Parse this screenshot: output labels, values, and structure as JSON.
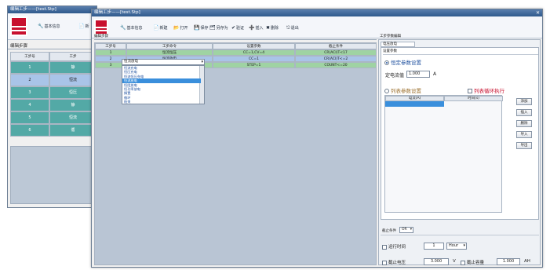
{
  "back_window": {
    "title_prefix": "编辑工步——",
    "title_file": "[test.Stp]",
    "toolbar": [
      {
        "icon": "wrench-icon",
        "label": "基本信息"
      },
      {
        "icon": "new-file-icon",
        "label": "新"
      }
    ],
    "section_title": "编辑步骤",
    "columns": [
      "工步号",
      "工步"
    ],
    "rows": [
      {
        "no": "1",
        "name": "静",
        "style": "teal"
      },
      {
        "no": "2",
        "name": "恒流",
        "style": "blue"
      },
      {
        "no": "3",
        "name": "恒压",
        "style": "teal"
      },
      {
        "no": "4",
        "name": "静",
        "style": "teal"
      },
      {
        "no": "5",
        "name": "恒流",
        "style": "teal"
      },
      {
        "no": "6",
        "name": "循",
        "style": "teal"
      }
    ]
  },
  "front_window": {
    "title": "编辑工步——[test.Stp]",
    "toolbar": [
      {
        "icon": "wrench-icon",
        "label": "基本信息"
      },
      {
        "icon": "new-file-icon",
        "label": "新建"
      },
      {
        "icon": "folder-open-icon",
        "label": "打开"
      },
      {
        "icon": "save-icon",
        "label": "保存"
      },
      {
        "icon": "save-as-icon",
        "label": "另存为"
      },
      {
        "icon": "check-icon",
        "label": "验证"
      },
      {
        "icon": "insert-icon",
        "label": "插入"
      },
      {
        "icon": "delete-icon",
        "label": "删除"
      },
      {
        "icon": "exit-icon",
        "label": "退出"
      }
    ],
    "section_title": "编辑步骤",
    "columns": [
      "工步号",
      "工步命令",
      "设置参数",
      "截止条件"
    ],
    "rows": [
      {
        "no": "1",
        "cmd": "恒流恒压",
        "param": "CC=1,CV=4",
        "cutoff": "CR(ACI)T<17",
        "style": "green"
      },
      {
        "no": "2",
        "cmd": "恒流放电",
        "param": "CC=1",
        "cutoff": "CR(ACI)T<=2",
        "style": "blue"
      },
      {
        "no": "3",
        "cmd": "",
        "param": "STEP=1",
        "cutoff": "COUNT<=20",
        "style": "green"
      }
    ],
    "dropdown_options": [
      "恒流充电",
      "恒压充电",
      "恒流恒压充电",
      "恒流放电",
      "恒阻放电",
      "恒功率放电",
      "搁置",
      "循环",
      "结束"
    ],
    "dropdown_selected_index": 3
  },
  "right_panel": {
    "title": "工步参数编辑",
    "tab": "电压放电",
    "sub_title": "设置参数",
    "fixed_mode": "恒定参数设置",
    "fixed_value_label": "定电流值",
    "fixed_value": "1.000",
    "fixed_unit": "A",
    "list_mode": "列表参数设置",
    "list_loop_label": "列表循环执行",
    "list_columns": [
      "电流(A)",
      "时间(s)"
    ],
    "buttons": [
      "添加",
      "插入",
      "删除",
      "导入",
      "导出"
    ],
    "cutoff_label": "截止条件",
    "cutoff_logic": "OR",
    "run_time_label": "运行时间",
    "run_time_value": "1",
    "run_time_unit": "Hour",
    "cutoff_voltage_label": "截止电压",
    "cutoff_voltage_value": "3.000",
    "cutoff_voltage_unit": "V",
    "cutoff_capacity_label": "截止容量",
    "cutoff_capacity_value": "1.000",
    "cutoff_capacity_unit": "AH"
  }
}
